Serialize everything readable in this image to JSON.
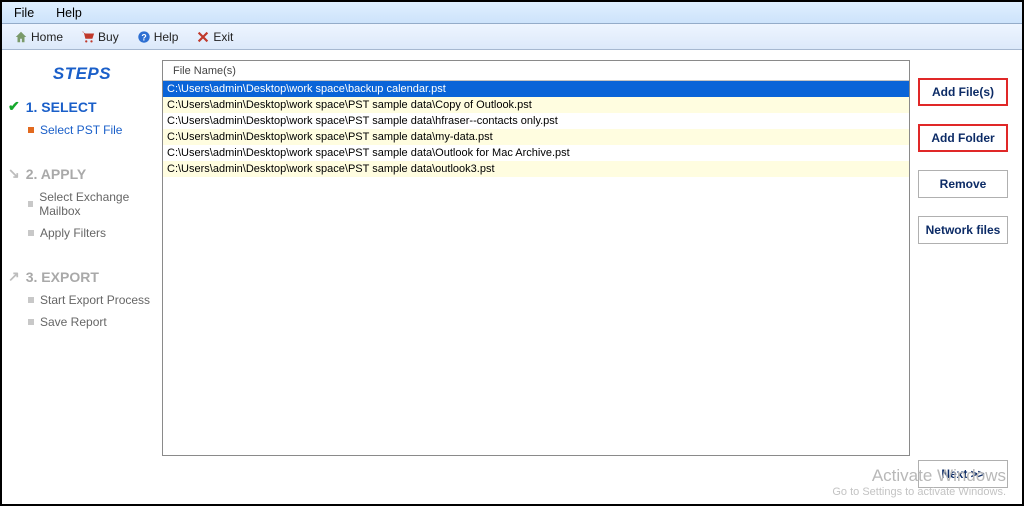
{
  "menubar": {
    "file": "File",
    "help": "Help"
  },
  "toolbar": {
    "home": "Home",
    "buy": "Buy",
    "help": "Help",
    "exit": "Exit"
  },
  "sidebar": {
    "title": "STEPS",
    "step1": {
      "label": "1. SELECT",
      "sub1": "Select PST File"
    },
    "step2": {
      "label": "2. APPLY",
      "sub1": "Select Exchange Mailbox",
      "sub2": "Apply Filters"
    },
    "step3": {
      "label": "3. EXPORT",
      "sub1": "Start Export Process",
      "sub2": "Save Report"
    }
  },
  "filelist": {
    "header": "File Name(s)",
    "rows": [
      "C:\\Users\\admin\\Desktop\\work space\\backup calendar.pst",
      "C:\\Users\\admin\\Desktop\\work space\\PST sample data\\Copy of Outlook.pst",
      "C:\\Users\\admin\\Desktop\\work space\\PST sample data\\hfraser--contacts only.pst",
      "C:\\Users\\admin\\Desktop\\work space\\PST sample data\\my-data.pst",
      "C:\\Users\\admin\\Desktop\\work space\\PST sample data\\Outlook for Mac Archive.pst",
      "C:\\Users\\admin\\Desktop\\work space\\PST sample data\\outlook3.pst"
    ],
    "selected_index": 0
  },
  "buttons": {
    "add_files": "Add File(s)",
    "add_folder": "Add Folder",
    "remove": "Remove",
    "network_files": "Network files",
    "next": "Next >>"
  },
  "watermark": {
    "line1": "Activate Windows",
    "line2": "Go to Settings to activate Windows."
  }
}
